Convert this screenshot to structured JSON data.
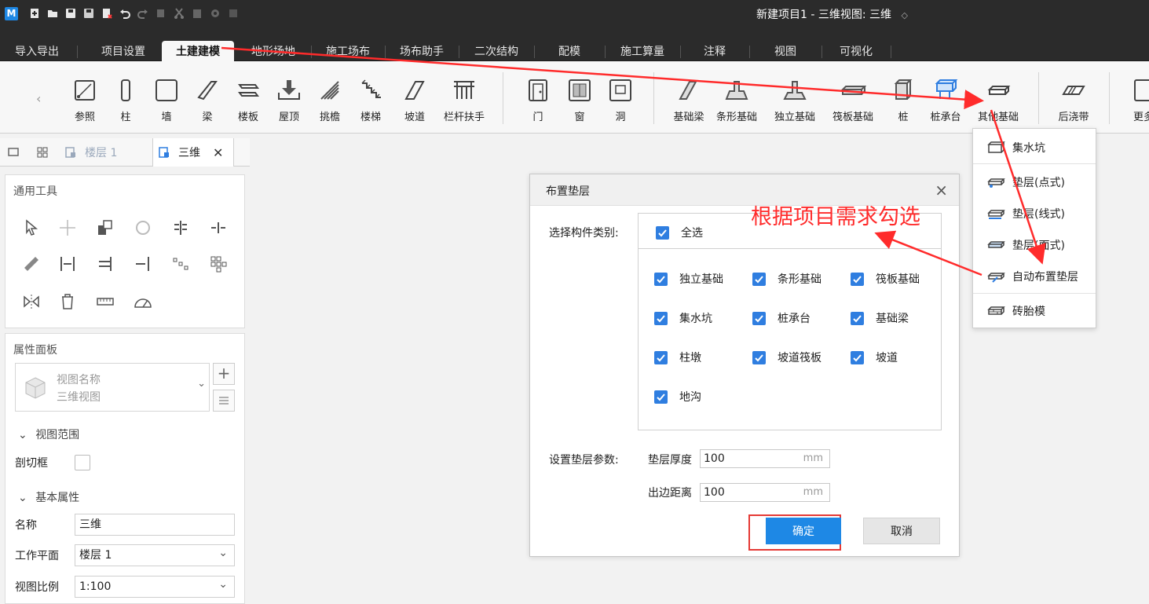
{
  "app": {
    "logo": "M",
    "window_title": "新建项目1 - 三维视图: 三维",
    "title_chevron": "◇"
  },
  "quick_access": [
    "new-icon",
    "open-icon",
    "save-icon",
    "save-as-icon",
    "close-doc-icon",
    "undo-icon",
    "redo-icon",
    "copy-icon",
    "cut-icon",
    "paste-icon",
    "settings-icon",
    "more-icon"
  ],
  "ribbon_tabs": [
    "导入导出",
    "项目设置",
    "土建建模",
    "地形场地",
    "施工场布",
    "场布助手",
    "二次结构",
    "配模",
    "施工算量",
    "注释",
    "视图",
    "可视化"
  ],
  "active_tab": "土建建模",
  "ribbon_buttons": {
    "group1": [
      "参照",
      "柱",
      "墙",
      "梁",
      "楼板",
      "屋顶",
      "挑檐",
      "楼梯",
      "坡道",
      "栏杆扶手"
    ],
    "group2": [
      "门",
      "窗",
      "洞"
    ],
    "group3": [
      "基础梁",
      "条形基础",
      "独立基础",
      "筏板基础",
      "桩",
      "桩承台",
      "其他基础"
    ],
    "group4": [
      "后浇带"
    ],
    "group5": [
      "更多"
    ]
  },
  "doc_tabs": {
    "floor_tab": "楼层 1",
    "view_tab": "三维",
    "close": "✕"
  },
  "tools_panel": {
    "title": "通用工具"
  },
  "props_panel": {
    "title": "属性面板",
    "view_name_label": "视图名称",
    "view_name_value": "三维视图",
    "section_view_range": "视图范围",
    "clip_box_label": "剖切框",
    "section_basic": "基本属性",
    "name_label": "名称",
    "name_value": "三维",
    "workplane_label": "工作平面",
    "workplane_value": "楼层 1",
    "scale_label": "视图比例",
    "scale_value": "1:100"
  },
  "dialog": {
    "title": "布置垫层",
    "select_label": "选择构件类别:",
    "select_all": "全选",
    "categories": [
      "独立基础",
      "条形基础",
      "筏板基础",
      "集水坑",
      "桩承台",
      "基础梁",
      "柱墩",
      "坡道筏板",
      "坡道",
      "地沟"
    ],
    "params_label": "设置垫层参数:",
    "thickness_label": "垫层厚度",
    "thickness_value": "100",
    "offset_label": "出边距离",
    "offset_value": "100",
    "unit": "mm",
    "ok": "确定",
    "cancel": "取消"
  },
  "dropdown": {
    "items": [
      "集水坑",
      "垫层(点式)",
      "垫层(线式)",
      "垫层(面式)",
      "自动布置垫层",
      "砖胎模"
    ]
  },
  "annotation": "根据项目需求勾选",
  "colors": {
    "accent_blue": "#2f7ee0",
    "annotation_red": "#ff2b2b",
    "title_bar": "#2b2b2b"
  }
}
